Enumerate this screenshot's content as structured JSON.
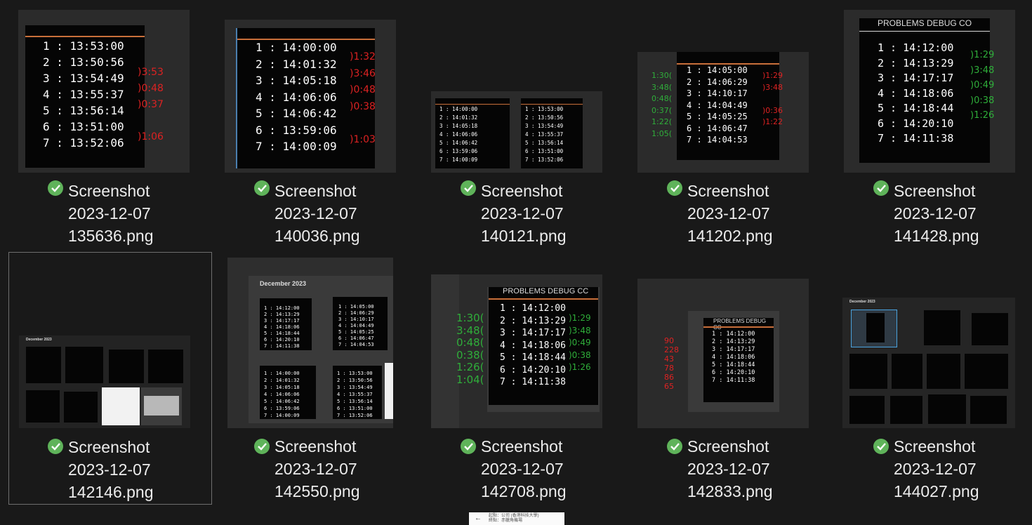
{
  "files": [
    {
      "line1": "Screenshot",
      "line2": "2023-12-07",
      "line3": "135636.png",
      "status": "synced-check-icon"
    },
    {
      "line1": "Screenshot",
      "line2": "2023-12-07",
      "line3": "140036.png",
      "status": "synced-check-icon"
    },
    {
      "line1": "Screenshot",
      "line2": "2023-12-07",
      "line3": "140121.png",
      "status": "synced-check-icon"
    },
    {
      "line1": "Screenshot",
      "line2": "2023-12-07",
      "line3": "141202.png",
      "status": "synced-check-icon"
    },
    {
      "line1": "Screenshot",
      "line2": "2023-12-07",
      "line3": "141428.png",
      "status": "synced-check-icon"
    },
    {
      "line1": "Screenshot",
      "line2": "2023-12-07",
      "line3": "142146.png",
      "status": "synced-check-icon"
    },
    {
      "line1": "Screenshot",
      "line2": "2023-12-07",
      "line3": "142550.png",
      "status": "synced-check-icon"
    },
    {
      "line1": "Screenshot",
      "line2": "2023-12-07",
      "line3": "142708.png",
      "status": "synced-check-icon"
    },
    {
      "line1": "Screenshot",
      "line2": "2023-12-07",
      "line3": "142833.png",
      "status": "synced-check-icon"
    },
    {
      "line1": "Screenshot",
      "line2": "2023-12-07",
      "line3": "144027.png",
      "status": "synced-check-icon"
    }
  ],
  "thumbs": {
    "t1": {
      "rows": "1 : 13:53:00\n2 : 13:50:56\n3 : 13:54:49\n4 : 13:55:37\n5 : 13:56:14\n6 : 13:51:00\n7 : 13:52:06",
      "notes": ")3:53\n)0:48\n)0:37\n\n)1:06"
    },
    "t2": {
      "rows": "1 : 14:00:00\n2 : 14:01:32\n3 : 14:05:18\n4 : 14:06:06\n5 : 14:06:42\n6 : 13:59:06\n7 : 14:00:09",
      "notes": ")1:32\n)3:46\n)0:48\n)0:38\n\n)1:03"
    },
    "t3a": {
      "rows": "1 : 14:00:00\n2 : 14:01:32\n3 : 14:05:18\n4 : 14:06:06\n5 : 14:06:42\n6 : 13:59:06\n7 : 14:00:09"
    },
    "t3b": {
      "rows": "1 : 13:53:00\n2 : 13:50:56\n3 : 13:54:49\n4 : 13:55:37\n5 : 13:56:14\n6 : 13:51:00\n7 : 13:52:06"
    },
    "t4": {
      "rows": "1 : 14:05:00\n2 : 14:06:29\n3 : 14:10:17\n4 : 14:04:49\n5 : 14:05:25\n6 : 14:06:47\n7 : 14:04:53",
      "notes_green": "1:30(\n3:48(\n0:48(\n0:37(\n1:22(\n1:05(",
      "notes_red": ")1:29\n)3:48\n\n)0:36\n)1:22"
    },
    "t5": {
      "header": "PROBLEMS     DEBUG CO",
      "rows": "1 : 14:12:00\n2 : 14:13:29\n3 : 14:17:17\n4 : 14:18:06\n5 : 14:18:44\n6 : 14:20:10\n7 : 14:11:38",
      "notes": ")1:29\n)3:48\n)0:49\n)0:38\n)1:26"
    },
    "t6": {
      "header": "December 2023"
    },
    "t7": {
      "header": "December 2023",
      "rowsA": "1 : 14:12:00\n2 : 14:13:29\n3 : 14:17:17\n4 : 14:18:06\n5 : 14:18:44\n6 : 14:20:10\n7 : 14:11:38",
      "rowsB": "1 : 14:05:00\n2 : 14:06:29\n3 : 14:10:17\n4 : 14:04:49\n5 : 14:05:25\n6 : 14:06:47\n7 : 14:04:53",
      "rowsC": "1 : 14:00:00\n2 : 14:01:32\n3 : 14:05:18\n4 : 14:06:06\n5 : 14:06:42\n6 : 13:59:06\n7 : 14:00:09",
      "rowsD": "1 : 13:53:00\n2 : 13:50:56\n3 : 13:54:49\n4 : 13:55:37\n5 : 13:56:14\n6 : 13:51:00\n7 : 13:52:06"
    },
    "t8": {
      "header": "PROBLEMS     DEBUG CC",
      "rows": "1 : 14:12:00\n2 : 14:13:29\n3 : 14:17:17\n4 : 14:18:06\n5 : 14:18:44\n6 : 14:20:10\n7 : 14:11:38",
      "notes_green": "1:30(\n3:48(\n0:48(\n0:38(\n1:26(\n1:04(",
      "notes_red": ")1:29\n)3:48\n)0:49\n)0:38\n)1:26"
    },
    "t9": {
      "header": "PROBLEMS     DEBUG CC",
      "rows": "1 : 14:12:00\n2 : 14:13:29\n3 : 14:17:17\n4 : 14:18:06\n5 : 14:18:44\n6 : 14:20:10\n7 : 14:11:38",
      "notes_red": "90\n228\n43\n78\n86\n65"
    },
    "t10": {
      "header": "December 2023"
    }
  },
  "popup": {
    "line1": "起點：公司 (香港科技大學)",
    "line2": "終點：赤臘角機場"
  }
}
